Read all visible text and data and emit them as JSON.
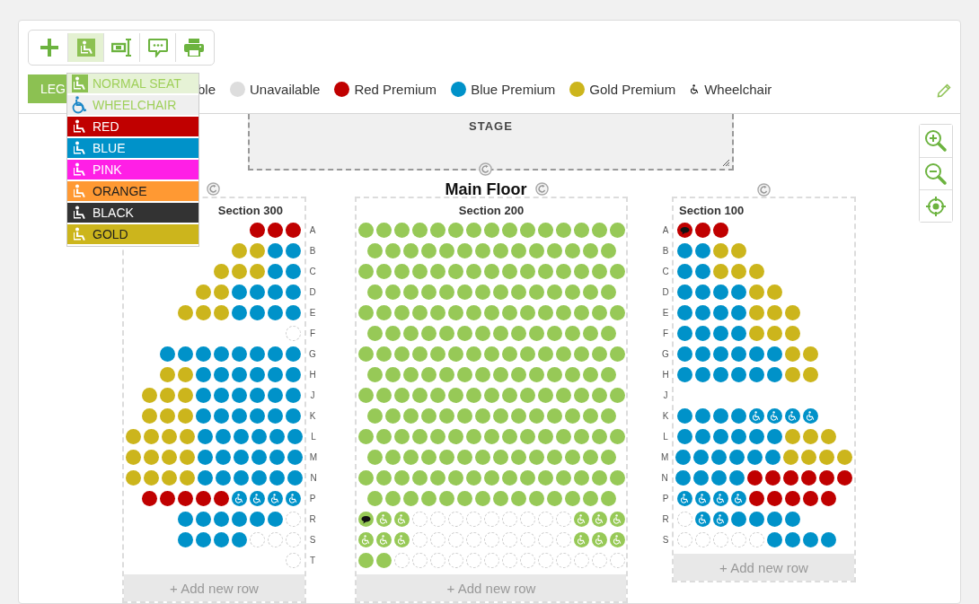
{
  "toolbar": [
    {
      "kind": "add",
      "selected": false
    },
    {
      "kind": "seat",
      "selected": true
    },
    {
      "kind": "row",
      "selected": false
    },
    {
      "kind": "comment",
      "selected": false
    },
    {
      "kind": "print",
      "selected": false
    }
  ],
  "seat_menu": [
    {
      "kind": "seat",
      "label": "NORMAL SEAT",
      "selected": true
    },
    {
      "kind": "wheelchair",
      "label": "WHEELCHAIR",
      "selected": false
    },
    {
      "kind": "seat",
      "label": "RED",
      "color": "#c00000",
      "selected": false
    },
    {
      "kind": "seat",
      "label": "BLUE",
      "color": "#0092c9",
      "selected": false
    },
    {
      "kind": "seat",
      "label": "PINK",
      "color": "#ff1fe6",
      "selected": false
    },
    {
      "kind": "seat",
      "label": "ORANGE",
      "color": "#ff9933",
      "selected": false
    },
    {
      "kind": "seat",
      "label": "BLACK",
      "color": "#333333",
      "selected": false
    },
    {
      "kind": "seat",
      "label": "GOLD",
      "color": "#ccb51c",
      "selected": false
    }
  ],
  "legend": {
    "button": "LEG",
    "items": [
      {
        "kind": "text",
        "label": "ble"
      },
      {
        "kind": "dot",
        "label": "Unavailable",
        "color": "#dddddd"
      },
      {
        "kind": "dot",
        "label": "Red Premium",
        "color": "#c00000"
      },
      {
        "kind": "dot",
        "label": "Blue Premium",
        "color": "#0092c9"
      },
      {
        "kind": "dot",
        "label": "Gold Premium",
        "color": "#ccb51c"
      },
      {
        "kind": "wheelchair",
        "label": "Wheelchair"
      }
    ]
  },
  "stage": {
    "label": "STAGE"
  },
  "floor": {
    "title": "Main Floor"
  },
  "sections": [
    {
      "kind": "right",
      "title": "Section 300",
      "add_row": "+ Add new row",
      "rows": [
        {
          "label": "A",
          "seats": [
            {
              "kind": "red"
            },
            {
              "kind": "red"
            },
            {
              "kind": "red"
            }
          ]
        },
        {
          "label": "B",
          "seats": [
            {
              "kind": "gold"
            },
            {
              "kind": "gold"
            },
            {
              "kind": "blue"
            },
            {
              "kind": "blue"
            }
          ]
        },
        {
          "label": "C",
          "seats": [
            {
              "kind": "gold"
            },
            {
              "kind": "gold"
            },
            {
              "kind": "gold"
            },
            {
              "kind": "blue"
            },
            {
              "kind": "blue"
            }
          ]
        },
        {
          "label": "D",
          "seats": [
            {
              "kind": "gold"
            },
            {
              "kind": "gold"
            },
            {
              "kind": "blue"
            },
            {
              "kind": "blue"
            },
            {
              "kind": "blue"
            },
            {
              "kind": "blue"
            }
          ]
        },
        {
          "label": "E",
          "seats": [
            {
              "kind": "gold"
            },
            {
              "kind": "gold"
            },
            {
              "kind": "gold"
            },
            {
              "kind": "blue"
            },
            {
              "kind": "blue"
            },
            {
              "kind": "blue"
            },
            {
              "kind": "blue"
            }
          ]
        },
        {
          "label": "F",
          "seats": [
            {
              "kind": "empty"
            }
          ]
        },
        {
          "label": "G",
          "seats": [
            {
              "kind": "blue"
            },
            {
              "kind": "blue"
            },
            {
              "kind": "blue"
            },
            {
              "kind": "blue"
            },
            {
              "kind": "blue"
            },
            {
              "kind": "blue"
            },
            {
              "kind": "blue"
            },
            {
              "kind": "blue"
            }
          ]
        },
        {
          "label": "H",
          "seats": [
            {
              "kind": "gold"
            },
            {
              "kind": "gold"
            },
            {
              "kind": "blue"
            },
            {
              "kind": "blue"
            },
            {
              "kind": "blue"
            },
            {
              "kind": "blue"
            },
            {
              "kind": "blue"
            },
            {
              "kind": "blue"
            }
          ]
        },
        {
          "label": "J",
          "seats": [
            {
              "kind": "gold"
            },
            {
              "kind": "gold"
            },
            {
              "kind": "gold"
            },
            {
              "kind": "blue"
            },
            {
              "kind": "blue"
            },
            {
              "kind": "blue"
            },
            {
              "kind": "blue"
            },
            {
              "kind": "blue"
            },
            {
              "kind": "blue"
            }
          ]
        },
        {
          "label": "K",
          "seats": [
            {
              "kind": "gold"
            },
            {
              "kind": "gold"
            },
            {
              "kind": "gold"
            },
            {
              "kind": "blue"
            },
            {
              "kind": "blue"
            },
            {
              "kind": "blue"
            },
            {
              "kind": "blue"
            },
            {
              "kind": "blue"
            },
            {
              "kind": "blue"
            }
          ]
        },
        {
          "label": "L",
          "seats": [
            {
              "kind": "gold"
            },
            {
              "kind": "gold"
            },
            {
              "kind": "gold"
            },
            {
              "kind": "gold"
            },
            {
              "kind": "blue"
            },
            {
              "kind": "blue"
            },
            {
              "kind": "blue"
            },
            {
              "kind": "blue"
            },
            {
              "kind": "blue"
            },
            {
              "kind": "blue"
            }
          ]
        },
        {
          "label": "M",
          "seats": [
            {
              "kind": "gold"
            },
            {
              "kind": "gold"
            },
            {
              "kind": "gold"
            },
            {
              "kind": "gold"
            },
            {
              "kind": "blue"
            },
            {
              "kind": "blue"
            },
            {
              "kind": "blue"
            },
            {
              "kind": "blue"
            },
            {
              "kind": "blue"
            },
            {
              "kind": "blue"
            }
          ]
        },
        {
          "label": "N",
          "seats": [
            {
              "kind": "gold"
            },
            {
              "kind": "gold"
            },
            {
              "kind": "gold"
            },
            {
              "kind": "gold"
            },
            {
              "kind": "blue"
            },
            {
              "kind": "blue"
            },
            {
              "kind": "blue"
            },
            {
              "kind": "blue"
            },
            {
              "kind": "blue"
            },
            {
              "kind": "blue"
            }
          ]
        },
        {
          "label": "P",
          "seats": [
            {
              "kind": "red"
            },
            {
              "kind": "red"
            },
            {
              "kind": "red"
            },
            {
              "kind": "red"
            },
            {
              "kind": "red"
            },
            {
              "kind": "bluewheelchair"
            },
            {
              "kind": "bluewheelchair"
            },
            {
              "kind": "bluewheelchair"
            },
            {
              "kind": "bluewheelchair"
            }
          ]
        },
        {
          "label": "R",
          "seats": [
            {
              "kind": "blue"
            },
            {
              "kind": "blue"
            },
            {
              "kind": "blue"
            },
            {
              "kind": "blue"
            },
            {
              "kind": "blue"
            },
            {
              "kind": "blue"
            },
            {
              "kind": "empty"
            }
          ]
        },
        {
          "label": "S",
          "seats": [
            {
              "kind": "blue"
            },
            {
              "kind": "blue"
            },
            {
              "kind": "blue"
            },
            {
              "kind": "blue"
            },
            {
              "kind": "empty"
            },
            {
              "kind": "empty"
            },
            {
              "kind": "empty"
            }
          ]
        },
        {
          "label": "T",
          "seats": [
            {
              "kind": "empty"
            }
          ]
        }
      ]
    },
    {
      "kind": "center",
      "title": "Section 200",
      "add_row": "+ Add new row",
      "rows": [
        {
          "seats": [
            {
              "kind": "green"
            },
            {
              "kind": "green"
            },
            {
              "kind": "green"
            },
            {
              "kind": "green"
            },
            {
              "kind": "green"
            },
            {
              "kind": "green"
            },
            {
              "kind": "green"
            },
            {
              "kind": "green"
            },
            {
              "kind": "green"
            },
            {
              "kind": "green"
            },
            {
              "kind": "green"
            },
            {
              "kind": "green"
            },
            {
              "kind": "green"
            },
            {
              "kind": "green"
            },
            {
              "kind": "green"
            }
          ]
        },
        {
          "seats": [
            {
              "kind": "green"
            },
            {
              "kind": "green"
            },
            {
              "kind": "green"
            },
            {
              "kind": "green"
            },
            {
              "kind": "green"
            },
            {
              "kind": "green"
            },
            {
              "kind": "green"
            },
            {
              "kind": "green"
            },
            {
              "kind": "green"
            },
            {
              "kind": "green"
            },
            {
              "kind": "green"
            },
            {
              "kind": "green"
            },
            {
              "kind": "green"
            },
            {
              "kind": "green"
            }
          ]
        },
        {
          "seats": [
            {
              "kind": "green"
            },
            {
              "kind": "green"
            },
            {
              "kind": "green"
            },
            {
              "kind": "green"
            },
            {
              "kind": "green"
            },
            {
              "kind": "green"
            },
            {
              "kind": "green"
            },
            {
              "kind": "green"
            },
            {
              "kind": "green"
            },
            {
              "kind": "green"
            },
            {
              "kind": "green"
            },
            {
              "kind": "green"
            },
            {
              "kind": "green"
            },
            {
              "kind": "green"
            },
            {
              "kind": "green"
            }
          ]
        },
        {
          "seats": [
            {
              "kind": "green"
            },
            {
              "kind": "green"
            },
            {
              "kind": "green"
            },
            {
              "kind": "green"
            },
            {
              "kind": "green"
            },
            {
              "kind": "green"
            },
            {
              "kind": "green"
            },
            {
              "kind": "green"
            },
            {
              "kind": "green"
            },
            {
              "kind": "green"
            },
            {
              "kind": "green"
            },
            {
              "kind": "green"
            },
            {
              "kind": "green"
            },
            {
              "kind": "green"
            }
          ]
        },
        {
          "seats": [
            {
              "kind": "green"
            },
            {
              "kind": "green"
            },
            {
              "kind": "green"
            },
            {
              "kind": "green"
            },
            {
              "kind": "green"
            },
            {
              "kind": "green"
            },
            {
              "kind": "green"
            },
            {
              "kind": "green"
            },
            {
              "kind": "green"
            },
            {
              "kind": "green"
            },
            {
              "kind": "green"
            },
            {
              "kind": "green"
            },
            {
              "kind": "green"
            },
            {
              "kind": "green"
            },
            {
              "kind": "green"
            }
          ]
        },
        {
          "seats": [
            {
              "kind": "green"
            },
            {
              "kind": "green"
            },
            {
              "kind": "green"
            },
            {
              "kind": "green"
            },
            {
              "kind": "green"
            },
            {
              "kind": "green"
            },
            {
              "kind": "green"
            },
            {
              "kind": "green"
            },
            {
              "kind": "green"
            },
            {
              "kind": "green"
            },
            {
              "kind": "green"
            },
            {
              "kind": "green"
            },
            {
              "kind": "green"
            },
            {
              "kind": "green"
            }
          ]
        },
        {
          "seats": [
            {
              "kind": "green"
            },
            {
              "kind": "green"
            },
            {
              "kind": "green"
            },
            {
              "kind": "green"
            },
            {
              "kind": "green"
            },
            {
              "kind": "green"
            },
            {
              "kind": "green"
            },
            {
              "kind": "green"
            },
            {
              "kind": "green"
            },
            {
              "kind": "green"
            },
            {
              "kind": "green"
            },
            {
              "kind": "green"
            },
            {
              "kind": "green"
            },
            {
              "kind": "green"
            },
            {
              "kind": "green"
            }
          ]
        },
        {
          "seats": [
            {
              "kind": "green"
            },
            {
              "kind": "green"
            },
            {
              "kind": "green"
            },
            {
              "kind": "green"
            },
            {
              "kind": "green"
            },
            {
              "kind": "green"
            },
            {
              "kind": "green"
            },
            {
              "kind": "green"
            },
            {
              "kind": "green"
            },
            {
              "kind": "green"
            },
            {
              "kind": "green"
            },
            {
              "kind": "green"
            },
            {
              "kind": "green"
            },
            {
              "kind": "green"
            }
          ]
        },
        {
          "seats": [
            {
              "kind": "green"
            },
            {
              "kind": "green"
            },
            {
              "kind": "green"
            },
            {
              "kind": "green"
            },
            {
              "kind": "green"
            },
            {
              "kind": "green"
            },
            {
              "kind": "green"
            },
            {
              "kind": "green"
            },
            {
              "kind": "green"
            },
            {
              "kind": "green"
            },
            {
              "kind": "green"
            },
            {
              "kind": "green"
            },
            {
              "kind": "green"
            },
            {
              "kind": "green"
            },
            {
              "kind": "green"
            }
          ]
        },
        {
          "seats": [
            {
              "kind": "green"
            },
            {
              "kind": "green"
            },
            {
              "kind": "green"
            },
            {
              "kind": "green"
            },
            {
              "kind": "green"
            },
            {
              "kind": "green"
            },
            {
              "kind": "green"
            },
            {
              "kind": "green"
            },
            {
              "kind": "green"
            },
            {
              "kind": "green"
            },
            {
              "kind": "green"
            },
            {
              "kind": "green"
            },
            {
              "kind": "green"
            },
            {
              "kind": "green"
            }
          ]
        },
        {
          "seats": [
            {
              "kind": "green"
            },
            {
              "kind": "green"
            },
            {
              "kind": "green"
            },
            {
              "kind": "green"
            },
            {
              "kind": "green"
            },
            {
              "kind": "green"
            },
            {
              "kind": "green"
            },
            {
              "kind": "green"
            },
            {
              "kind": "green"
            },
            {
              "kind": "green"
            },
            {
              "kind": "green"
            },
            {
              "kind": "green"
            },
            {
              "kind": "green"
            },
            {
              "kind": "green"
            },
            {
              "kind": "green"
            }
          ]
        },
        {
          "seats": [
            {
              "kind": "green"
            },
            {
              "kind": "green"
            },
            {
              "kind": "green"
            },
            {
              "kind": "green"
            },
            {
              "kind": "green"
            },
            {
              "kind": "green"
            },
            {
              "kind": "green"
            },
            {
              "kind": "green"
            },
            {
              "kind": "green"
            },
            {
              "kind": "green"
            },
            {
              "kind": "green"
            },
            {
              "kind": "green"
            },
            {
              "kind": "green"
            },
            {
              "kind": "green"
            }
          ]
        },
        {
          "seats": [
            {
              "kind": "green"
            },
            {
              "kind": "green"
            },
            {
              "kind": "green"
            },
            {
              "kind": "green"
            },
            {
              "kind": "green"
            },
            {
              "kind": "green"
            },
            {
              "kind": "green"
            },
            {
              "kind": "green"
            },
            {
              "kind": "green"
            },
            {
              "kind": "green"
            },
            {
              "kind": "green"
            },
            {
              "kind": "green"
            },
            {
              "kind": "green"
            },
            {
              "kind": "green"
            },
            {
              "kind": "green"
            }
          ]
        },
        {
          "seats": [
            {
              "kind": "green"
            },
            {
              "kind": "green"
            },
            {
              "kind": "green"
            },
            {
              "kind": "green"
            },
            {
              "kind": "green"
            },
            {
              "kind": "green"
            },
            {
              "kind": "green"
            },
            {
              "kind": "green"
            },
            {
              "kind": "green"
            },
            {
              "kind": "green"
            },
            {
              "kind": "green"
            },
            {
              "kind": "green"
            },
            {
              "kind": "green"
            },
            {
              "kind": "green"
            }
          ]
        },
        {
          "seats": [
            {
              "kind": "greennote"
            },
            {
              "kind": "greenwheelchair"
            },
            {
              "kind": "greenwheelchair"
            },
            {
              "kind": "empty"
            },
            {
              "kind": "empty"
            },
            {
              "kind": "empty"
            },
            {
              "kind": "empty"
            },
            {
              "kind": "empty"
            },
            {
              "kind": "empty"
            },
            {
              "kind": "empty"
            },
            {
              "kind": "empty"
            },
            {
              "kind": "empty"
            },
            {
              "kind": "greenwheelchair"
            },
            {
              "kind": "greenwheelchair"
            },
            {
              "kind": "greenwheelchair"
            }
          ]
        },
        {
          "seats": [
            {
              "kind": "greenwheelchair"
            },
            {
              "kind": "greenwheelchair"
            },
            {
              "kind": "greenwheelchair"
            },
            {
              "kind": "empty"
            },
            {
              "kind": "empty"
            },
            {
              "kind": "empty"
            },
            {
              "kind": "empty"
            },
            {
              "kind": "empty"
            },
            {
              "kind": "empty"
            },
            {
              "kind": "empty"
            },
            {
              "kind": "empty"
            },
            {
              "kind": "empty"
            },
            {
              "kind": "greenwheelchair"
            },
            {
              "kind": "greenwheelchair"
            },
            {
              "kind": "greenwheelchair"
            }
          ]
        },
        {
          "seats": [
            {
              "kind": "green"
            },
            {
              "kind": "green"
            },
            {
              "kind": "empty"
            },
            {
              "kind": "empty"
            },
            {
              "kind": "empty"
            },
            {
              "kind": "empty"
            },
            {
              "kind": "empty"
            },
            {
              "kind": "empty"
            },
            {
              "kind": "empty"
            },
            {
              "kind": "empty"
            },
            {
              "kind": "empty"
            },
            {
              "kind": "empty"
            },
            {
              "kind": "empty"
            },
            {
              "kind": "empty"
            },
            {
              "kind": "empty"
            }
          ]
        }
      ]
    },
    {
      "kind": "left",
      "title": "Section 100",
      "add_row": "+ Add new row",
      "rows": [
        {
          "label": "A",
          "seats": [
            {
              "kind": "rednote"
            },
            {
              "kind": "red"
            },
            {
              "kind": "red"
            }
          ]
        },
        {
          "label": "B",
          "seats": [
            {
              "kind": "blue"
            },
            {
              "kind": "blue"
            },
            {
              "kind": "gold"
            },
            {
              "kind": "gold"
            }
          ]
        },
        {
          "label": "C",
          "seats": [
            {
              "kind": "blue"
            },
            {
              "kind": "blue"
            },
            {
              "kind": "gold"
            },
            {
              "kind": "gold"
            },
            {
              "kind": "gold"
            }
          ]
        },
        {
          "label": "D",
          "seats": [
            {
              "kind": "blue"
            },
            {
              "kind": "blue"
            },
            {
              "kind": "blue"
            },
            {
              "kind": "blue"
            },
            {
              "kind": "gold"
            },
            {
              "kind": "gold"
            }
          ]
        },
        {
          "label": "E",
          "seats": [
            {
              "kind": "blue"
            },
            {
              "kind": "blue"
            },
            {
              "kind": "blue"
            },
            {
              "kind": "blue"
            },
            {
              "kind": "gold"
            },
            {
              "kind": "gold"
            },
            {
              "kind": "gold"
            }
          ]
        },
        {
          "label": "F",
          "seats": [
            {
              "kind": "blue"
            },
            {
              "kind": "blue"
            },
            {
              "kind": "blue"
            },
            {
              "kind": "blue"
            },
            {
              "kind": "gold"
            },
            {
              "kind": "gold"
            },
            {
              "kind": "gold"
            }
          ]
        },
        {
          "label": "G",
          "seats": [
            {
              "kind": "blue"
            },
            {
              "kind": "blue"
            },
            {
              "kind": "blue"
            },
            {
              "kind": "blue"
            },
            {
              "kind": "blue"
            },
            {
              "kind": "blue"
            },
            {
              "kind": "gold"
            },
            {
              "kind": "gold"
            }
          ]
        },
        {
          "label": "H",
          "seats": [
            {
              "kind": "blue"
            },
            {
              "kind": "blue"
            },
            {
              "kind": "blue"
            },
            {
              "kind": "blue"
            },
            {
              "kind": "blue"
            },
            {
              "kind": "blue"
            },
            {
              "kind": "gold"
            },
            {
              "kind": "gold"
            }
          ]
        },
        {
          "label": "J",
          "seats": []
        },
        {
          "label": "K",
          "seats": [
            {
              "kind": "blue"
            },
            {
              "kind": "blue"
            },
            {
              "kind": "blue"
            },
            {
              "kind": "blue"
            },
            {
              "kind": "bluewheelchair"
            },
            {
              "kind": "bluewheelchair"
            },
            {
              "kind": "bluewheelchair"
            },
            {
              "kind": "bluewheelchair"
            }
          ]
        },
        {
          "label": "L",
          "seats": [
            {
              "kind": "blue"
            },
            {
              "kind": "blue"
            },
            {
              "kind": "blue"
            },
            {
              "kind": "blue"
            },
            {
              "kind": "blue"
            },
            {
              "kind": "blue"
            },
            {
              "kind": "gold"
            },
            {
              "kind": "gold"
            },
            {
              "kind": "gold"
            }
          ]
        },
        {
          "label": "M",
          "seats": [
            {
              "kind": "blue"
            },
            {
              "kind": "blue"
            },
            {
              "kind": "blue"
            },
            {
              "kind": "blue"
            },
            {
              "kind": "blue"
            },
            {
              "kind": "blue"
            },
            {
              "kind": "gold"
            },
            {
              "kind": "gold"
            },
            {
              "kind": "gold"
            },
            {
              "kind": "gold"
            }
          ]
        },
        {
          "label": "N",
          "seats": [
            {
              "kind": "blue"
            },
            {
              "kind": "blue"
            },
            {
              "kind": "blue"
            },
            {
              "kind": "blue"
            },
            {
              "kind": "red"
            },
            {
              "kind": "red"
            },
            {
              "kind": "red"
            },
            {
              "kind": "red"
            },
            {
              "kind": "red"
            },
            {
              "kind": "red"
            }
          ]
        },
        {
          "label": "P",
          "seats": [
            {
              "kind": "bluewheelchair"
            },
            {
              "kind": "bluewheelchair"
            },
            {
              "kind": "bluewheelchair"
            },
            {
              "kind": "bluewheelchair"
            },
            {
              "kind": "red"
            },
            {
              "kind": "red"
            },
            {
              "kind": "red"
            },
            {
              "kind": "red"
            },
            {
              "kind": "red"
            }
          ]
        },
        {
          "label": "R",
          "seats": [
            {
              "kind": "empty"
            },
            {
              "kind": "bluewheelchair"
            },
            {
              "kind": "bluewheelchair"
            },
            {
              "kind": "blue"
            },
            {
              "kind": "blue"
            },
            {
              "kind": "blue"
            },
            {
              "kind": "blue"
            }
          ]
        },
        {
          "label": "S",
          "seats": [
            {
              "kind": "empty"
            },
            {
              "kind": "empty"
            },
            {
              "kind": "empty"
            },
            {
              "kind": "empty"
            },
            {
              "kind": "empty"
            },
            {
              "kind": "blue"
            },
            {
              "kind": "blue"
            },
            {
              "kind": "blue"
            },
            {
              "kind": "blue"
            }
          ]
        }
      ]
    }
  ]
}
